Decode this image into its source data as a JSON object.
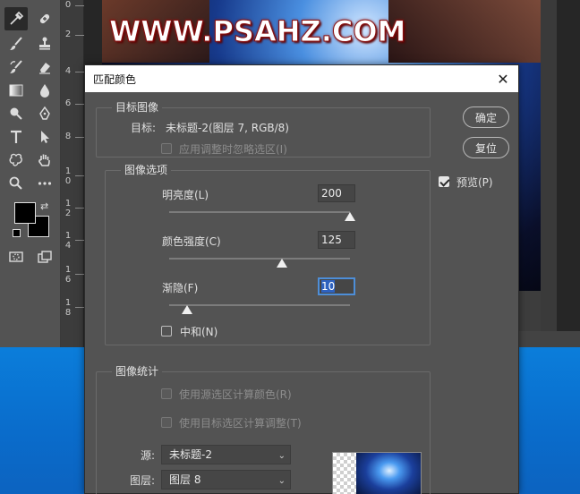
{
  "watermark": "WWW.PSAHZ.COM",
  "ruler_numbers": [
    "0",
    "2",
    "4",
    "6",
    "8",
    "1\n0",
    "1\n2",
    "1\n4",
    "1\n6",
    "1\n8"
  ],
  "dialog": {
    "title": "匹配颜色",
    "target_image": {
      "group_label": "目标图像",
      "target_label": "目标:",
      "target_value": "未标题-2(图层 7, RGB/8)",
      "ignore_selection_label": "应用调整时忽略选区(I)"
    },
    "image_options": {
      "group_label": "图像选项",
      "luminance": {
        "label": "明亮度(L)",
        "value": "200",
        "fraction": 1.0
      },
      "color_intensity": {
        "label": "颜色强度(C)",
        "value": "125",
        "fraction": 0.625
      },
      "fade": {
        "label": "渐隐(F)",
        "value": "10",
        "fraction": 0.1
      },
      "neutralize_label": "中和(N)"
    },
    "image_statistics": {
      "group_label": "图像统计",
      "use_source_selection_label": "使用源选区计算颜色(R)",
      "use_target_selection_label": "使用目标选区计算调整(T)",
      "source_label": "源:",
      "source_value": "未标题-2",
      "layer_label": "图层:",
      "layer_value": "图层 8"
    },
    "ok_label": "确定",
    "reset_label": "复位",
    "preview_label": "预览(P)",
    "preview_checked": true,
    "close_symbol": "✕"
  },
  "colors": {
    "dialog_bg": "#535353",
    "accent_focus": "#4d8ed8",
    "desktop_blue": "#0a78d6"
  }
}
